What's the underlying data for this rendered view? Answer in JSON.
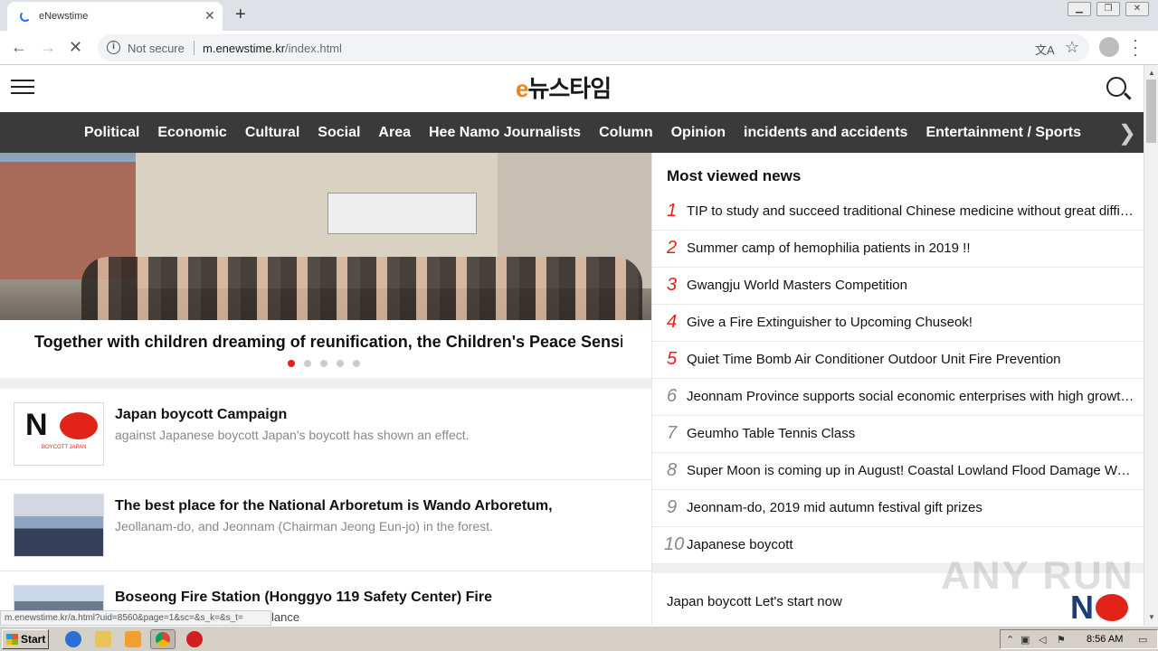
{
  "browser": {
    "tab_title": "eNewstime",
    "new_tab": "+",
    "security_label": "Not secure",
    "url_host": "m.enewstime.kr",
    "url_path": "/index.html",
    "status_url": "m.enewstime.kr/a.html?uid=8560&page=1&sc=&s_k=&s_t=",
    "status_tail": "lance"
  },
  "site": {
    "logo_text": "뉴스타임",
    "categories": [
      "Political",
      "Economic",
      "Cultural",
      "Social",
      "Area",
      "Hee Namo Journalists",
      "Column",
      "Opinion",
      "incidents and accidents",
      "Entertainment / Sports"
    ]
  },
  "hero": {
    "caption": "Together with children dreaming of reunification, the Children's Peace Sensi",
    "slide_count": 5,
    "active_slide": 1
  },
  "news": [
    {
      "title": "Japan boycott Campaign",
      "sub": "against Japanese boycott Japan's boycott has shown an effect.",
      "thumb_text": "BOYCOTT JAPAN"
    },
    {
      "title": "The best place for the National Arboretum is Wando Arboretum,",
      "sub": "Jeollanam-do, and Jeonnam (Chairman Jeong Eun-jo) in the forest."
    },
    {
      "title": "Boseong Fire Station (Honggyo 119 Safety Center) Fire",
      "sub": ""
    }
  ],
  "most_viewed": {
    "title": "Most viewed news",
    "items": [
      {
        "rank": "1",
        "text": "TIP to study and succeed traditional Chinese medicine without great difficulty"
      },
      {
        "rank": "2",
        "text": "Summer camp of hemophilia patients in 2019 !!"
      },
      {
        "rank": "3",
        "text": "Gwangju World Masters Competition"
      },
      {
        "rank": "4",
        "text": "Give a Fire Extinguisher to Upcoming Chuseok!"
      },
      {
        "rank": "5",
        "text": "Quiet Time Bomb Air Conditioner Outdoor Unit Fire Prevention"
      },
      {
        "rank": "6",
        "text": "Jeonnam Province supports social economic enterprises with high growth potential"
      },
      {
        "rank": "7",
        "text": "Geumho Table Tennis Class"
      },
      {
        "rank": "8",
        "text": "Super Moon is coming up in August! Coastal Lowland Flood Damage Warning"
      },
      {
        "rank": "9",
        "text": "Jeonnam-do, 2019 mid autumn festival gift prizes"
      },
      {
        "rank": "10",
        "text": "Japanese boycott"
      }
    ]
  },
  "bottom_link": "Japan boycott Let's start now",
  "watermark": "ANY RUN",
  "taskbar": {
    "start_label": "Start",
    "clock": "8:56 AM"
  },
  "colors": {
    "accent_red": "#e2231a",
    "nav_bg": "#3a3a3a"
  }
}
